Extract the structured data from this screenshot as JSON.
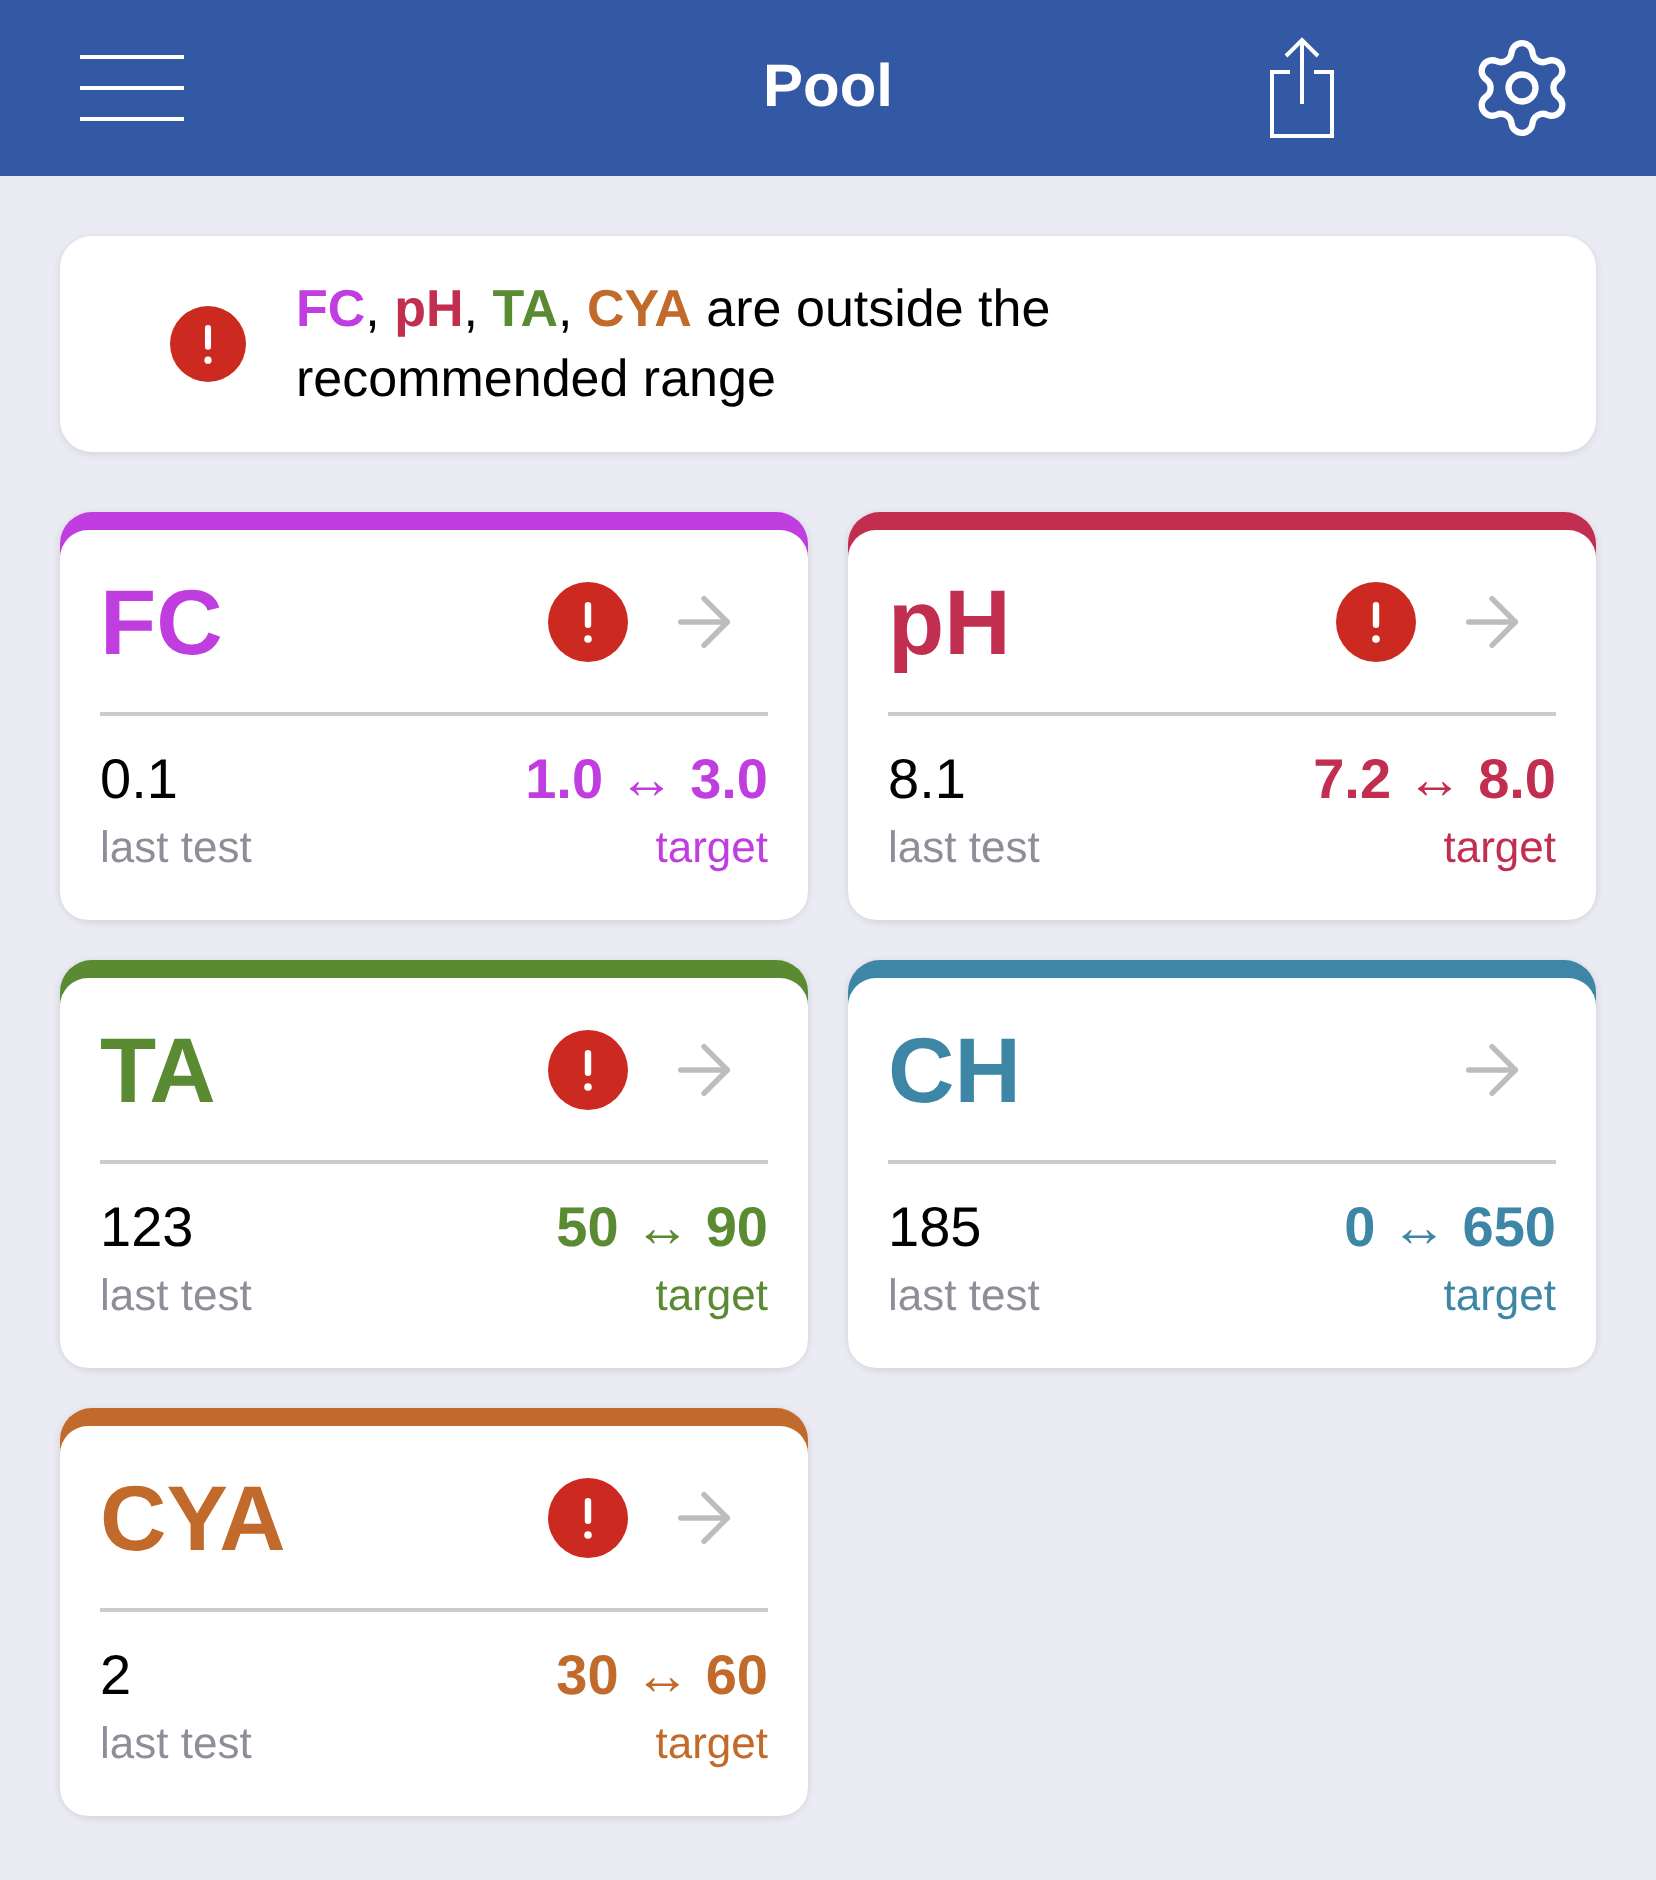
{
  "header": {
    "title": "Pool"
  },
  "alert": {
    "parts": [
      {
        "kind": "parameter",
        "text": "FC",
        "color": "#c03de0"
      },
      {
        "kind": "plain",
        "text": ", "
      },
      {
        "kind": "parameter",
        "text": "pH",
        "color": "#c22e4f"
      },
      {
        "kind": "plain",
        "text": ", "
      },
      {
        "kind": "parameter",
        "text": "TA",
        "color": "#5a8b32"
      },
      {
        "kind": "plain",
        "text": ", "
      },
      {
        "kind": "parameter",
        "text": "CYA",
        "color": "#c26a2b"
      },
      {
        "kind": "plain",
        "text": " are outside the recommended range"
      }
    ]
  },
  "cards": [
    {
      "name": "FC",
      "color": "#c03de0",
      "out_of_range": true,
      "last_test": "0.1",
      "last_test_label": "last test",
      "target": "1.0 ↔ 3.0",
      "target_label": "target"
    },
    {
      "name": "pH",
      "color": "#c22e4f",
      "out_of_range": true,
      "last_test": "8.1",
      "last_test_label": "last test",
      "target": "7.2 ↔ 8.0",
      "target_label": "target"
    },
    {
      "name": "TA",
      "color": "#5a8b32",
      "out_of_range": true,
      "last_test": "123",
      "last_test_label": "last test",
      "target": "50 ↔ 90",
      "target_label": "target"
    },
    {
      "name": "CH",
      "color": "#3e86a5",
      "out_of_range": false,
      "last_test": "185",
      "last_test_label": "last test",
      "target": "0 ↔ 650",
      "target_label": "target"
    },
    {
      "name": "CYA",
      "color": "#c26a2b",
      "out_of_range": true,
      "last_test": "2",
      "last_test_label": "last test",
      "target": "30 ↔ 60",
      "target_label": "target"
    }
  ]
}
